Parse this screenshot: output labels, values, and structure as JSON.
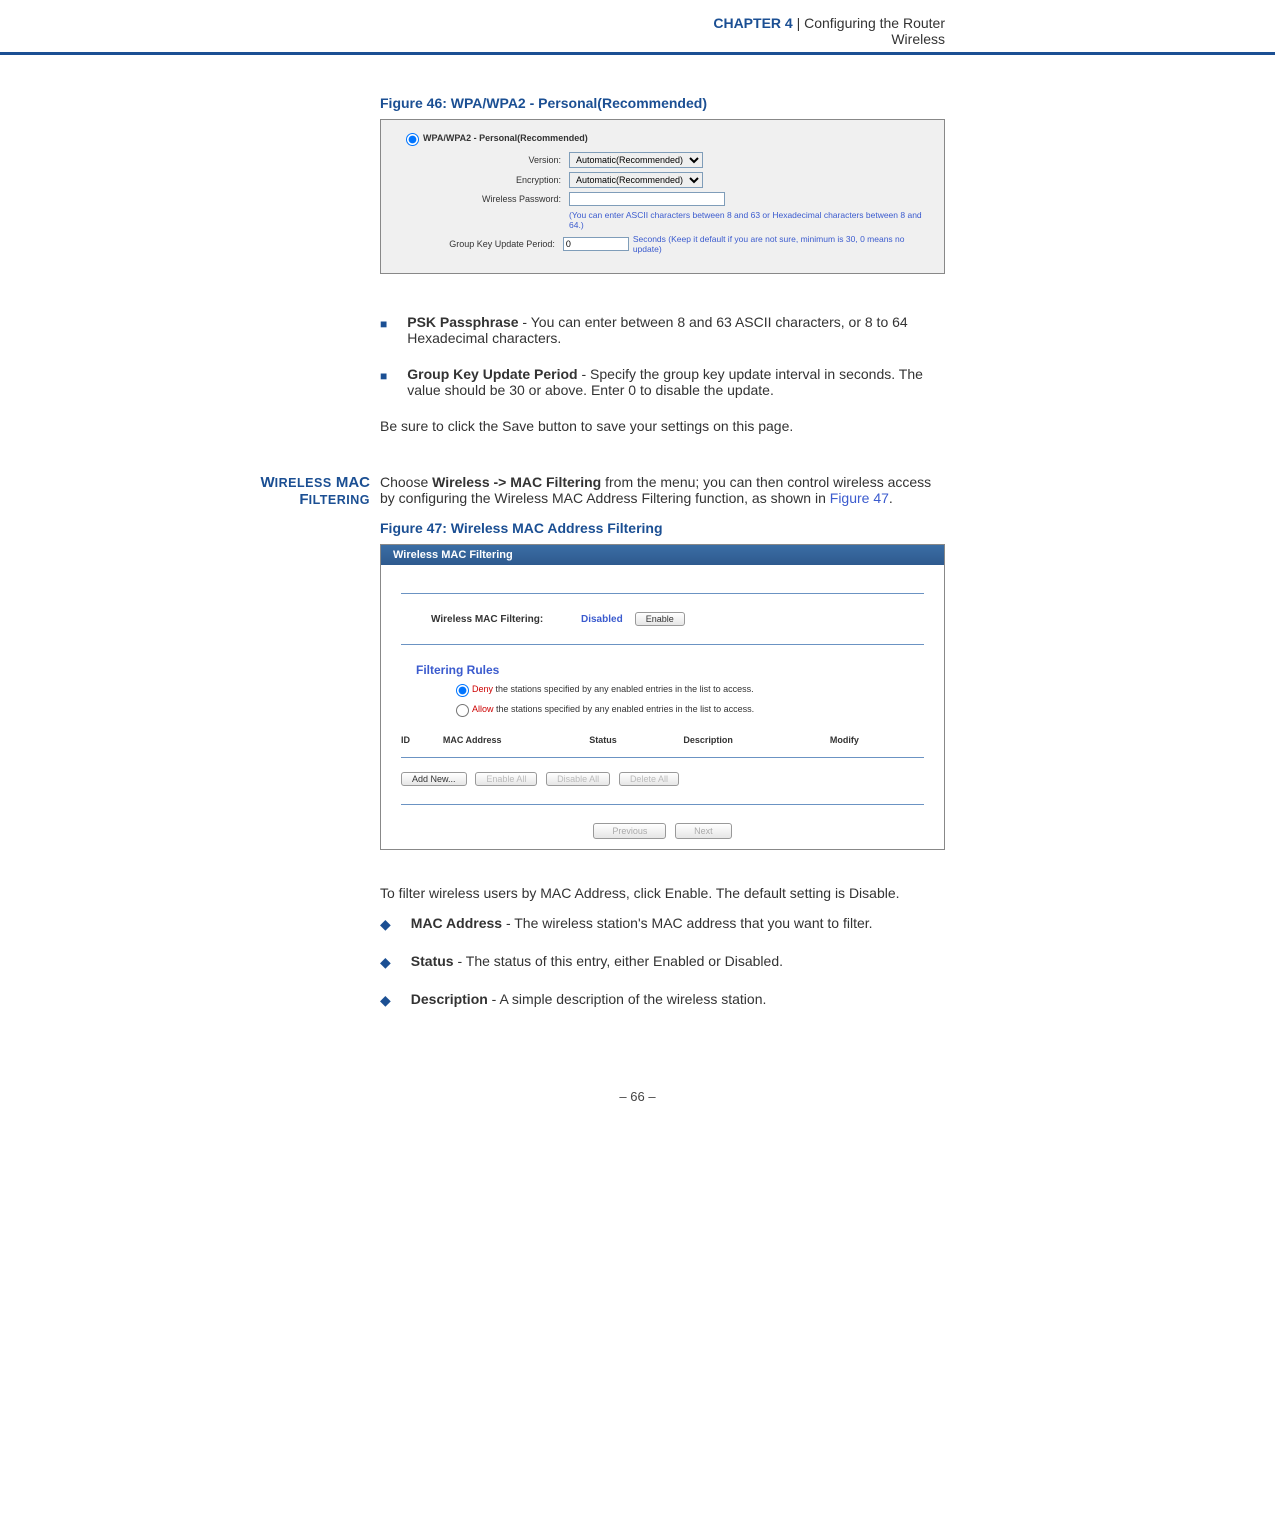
{
  "header": {
    "chapter_label": "CHAPTER 4",
    "divider": "  |  ",
    "title_line1": "Configuring the Router",
    "title_line2": "Wireless"
  },
  "figure46": {
    "caption": "Figure 46:  WPA/WPA2 - Personal(Recommended)",
    "radio_label": "WPA/WPA2 - Personal(Recommended)",
    "rows": {
      "version": {
        "label": "Version:",
        "value": "Automatic(Recommended)"
      },
      "encryption": {
        "label": "Encryption:",
        "value": "Automatic(Recommended)"
      },
      "wireless_pw": {
        "label": "Wireless Password:",
        "value": ""
      },
      "note": "(You can enter ASCII characters between 8 and 63 or Hexadecimal characters between 8 and 64.)",
      "gkup": {
        "label": "Group Key Update Period:",
        "value": "0",
        "suffix": "Seconds (Keep it default if you are not sure, minimum is 30, 0 means no update)"
      }
    }
  },
  "bullets1": {
    "b1_bold": "PSK Passphrase",
    "b1_text": " - You can enter between 8 and 63 ASCII characters, or 8 to 64 Hexadecimal characters.",
    "b2_bold": "Group Key Update Period",
    "b2_text": " - Specify the group key update interval in seconds. The value should be 30 or above. Enter 0 to disable the update."
  },
  "para_save": "Be sure to click the Save button to save your settings on this page.",
  "section_mac": {
    "sidebar_line1": "WIRELESS MAC",
    "sidebar_line2": "FILTERING",
    "intro_pre": "Choose ",
    "intro_bold": "Wireless -> MAC Filtering",
    "intro_mid": " from the menu; you can then control wireless access by configuring the Wireless MAC Address Filtering function, as shown in ",
    "intro_link": "Figure 47",
    "intro_end": "."
  },
  "figure47": {
    "caption": "Figure 47:  Wireless MAC Address Filtering",
    "titlebar": "Wireless MAC Filtering",
    "filter_row": {
      "label": "Wireless MAC Filtering:",
      "status": "Disabled",
      "button": "Enable"
    },
    "rules_heading": "Filtering Rules",
    "rule_deny": {
      "hl": "Deny",
      "rest": " the stations specified by any enabled entries in the list to access."
    },
    "rule_allow": {
      "hl": "Allow",
      "rest": " the stations specified by any enabled entries in the list to access."
    },
    "table_headers": [
      "ID",
      "MAC Address",
      "Status",
      "Description",
      "Modify"
    ],
    "buttons": {
      "add": "Add New...",
      "enable_all": "Enable All",
      "disable_all": "Disable All",
      "delete_all": "Delete All"
    },
    "pager": {
      "prev": "Previous",
      "next": "Next"
    }
  },
  "para_filter": "To filter wireless users by MAC Address, click Enable. The default setting is Disable.",
  "bullets2": {
    "b1_bold": "MAC Address",
    "b1_text": " - The wireless station's MAC address that you want to filter.",
    "b2_bold": "Status",
    "b2_text": " - The status of this entry, either Enabled or Disabled.",
    "b3_bold": "Description",
    "b3_text": " - A simple description of the wireless station."
  },
  "page_num": "–  66  –"
}
